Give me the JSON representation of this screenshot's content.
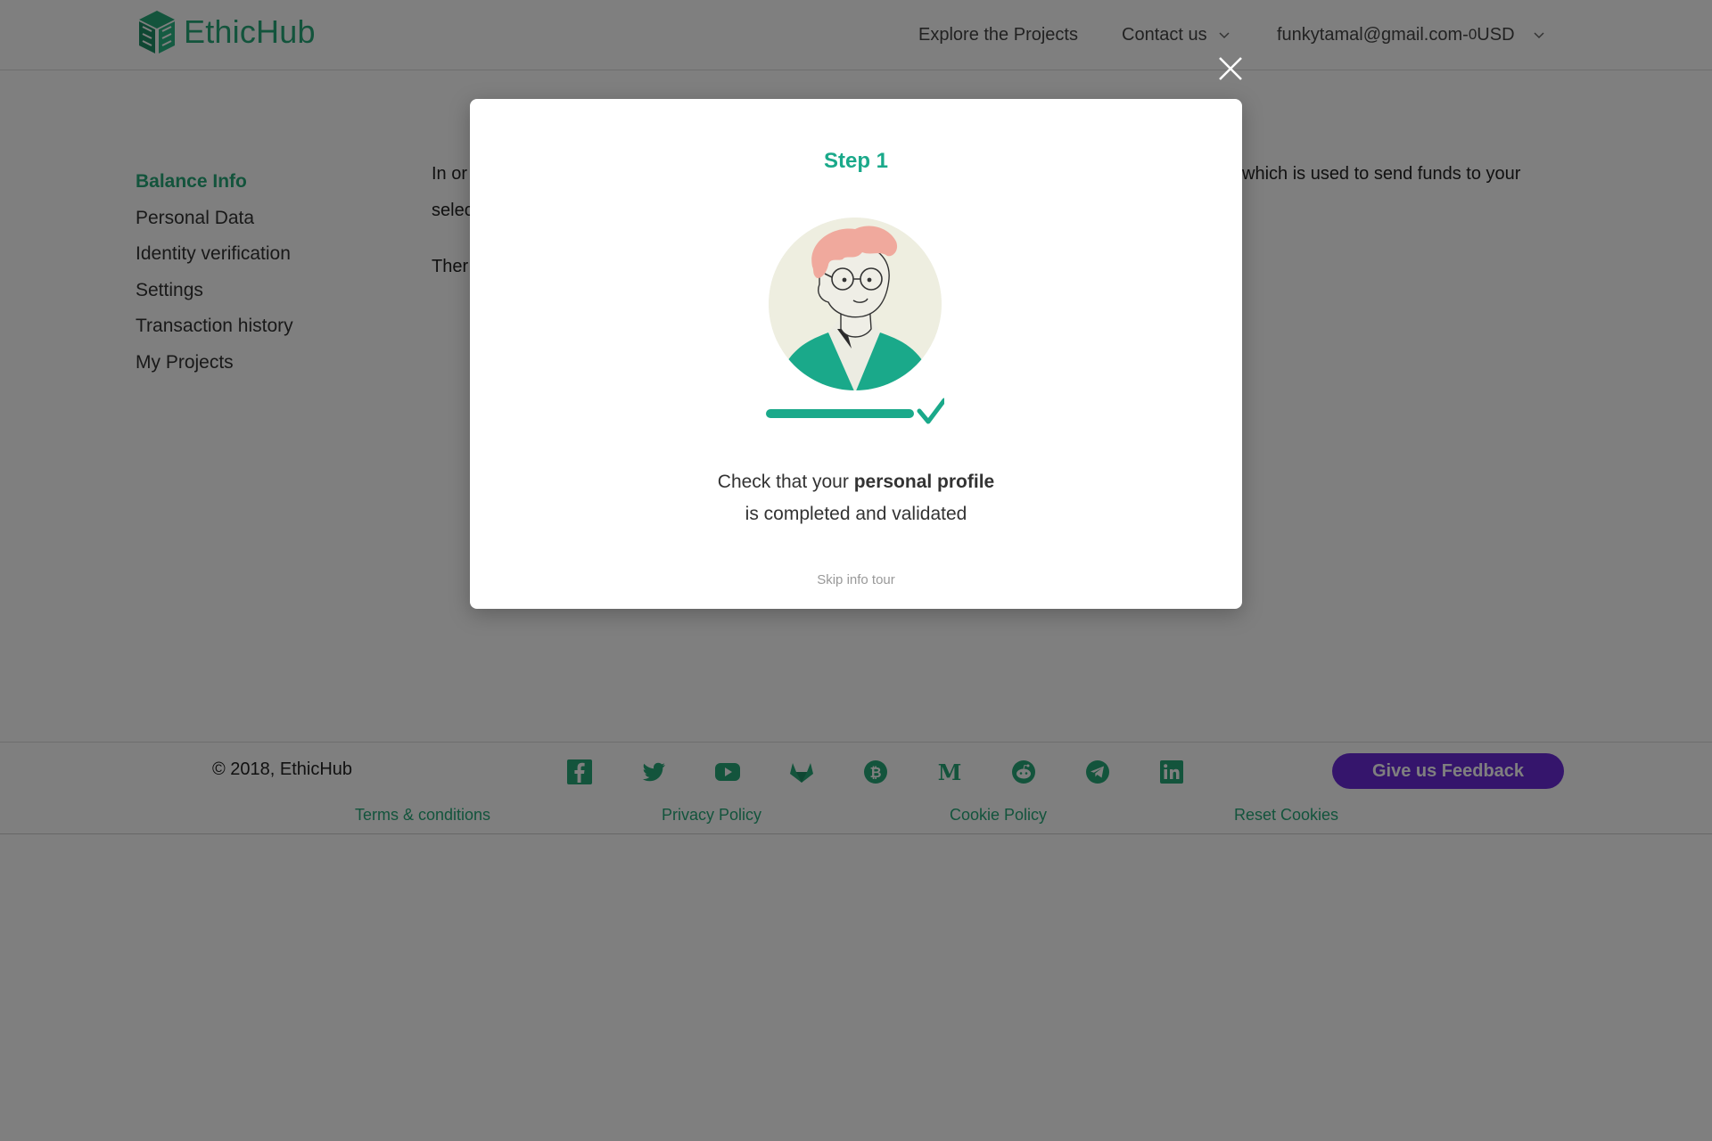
{
  "brand": {
    "name": "EthicHub",
    "color": "#27a879"
  },
  "nav": {
    "explore": "Explore the Projects",
    "contact": "Contact us",
    "email": "funkytamal@gmail.com",
    "balance_prefix": " - ",
    "balance_value": "0",
    "balance_currency": " USD"
  },
  "sidebar": {
    "items": [
      {
        "label": "Balance Info",
        "active": true
      },
      {
        "label": "Personal Data"
      },
      {
        "label": "Identity verification"
      },
      {
        "label": "Settings"
      },
      {
        "label": "Transaction history"
      },
      {
        "label": "My Projects"
      }
    ]
  },
  "content": {
    "line1_start": "In or",
    "line1_end": "which is used to send funds to your",
    "line2_start": "selec",
    "line3_start": "Ther"
  },
  "modal": {
    "step_title": "Step 1",
    "desc_prefix": "Check that your ",
    "desc_bold": "personal profile",
    "desc_suffix": "is completed and validated",
    "skip": "Skip info tour",
    "accent": "#1aa98a"
  },
  "footer": {
    "copyright": "© 2018, EthicHub",
    "feedback": "Give us Feedback",
    "feedback_color": "#6a2bd9",
    "links": [
      "Terms & conditions",
      "Privacy Policy",
      "Cookie Policy",
      "Reset Cookies"
    ],
    "social_icons": [
      "facebook-icon",
      "twitter-icon",
      "youtube-icon",
      "gitlab-icon",
      "bitcoin-icon",
      "medium-icon",
      "reddit-icon",
      "telegram-icon",
      "linkedin-icon"
    ]
  }
}
